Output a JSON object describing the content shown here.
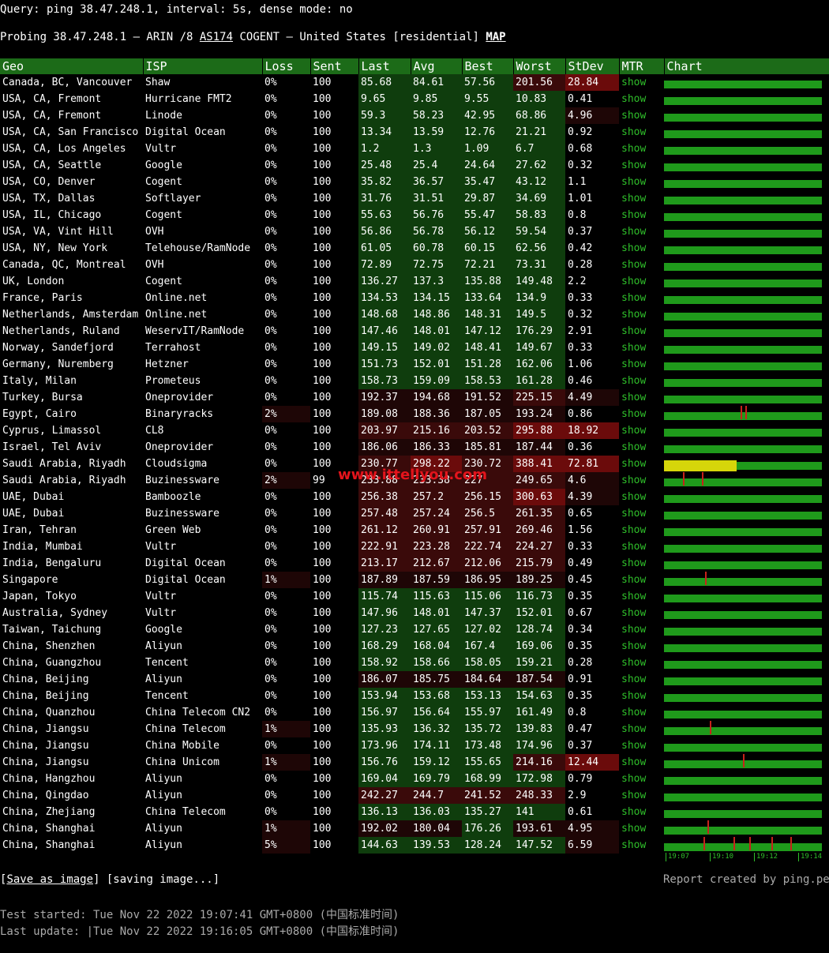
{
  "query_line": "Query: ping 38.47.248.1, interval: 5s, dense mode: no",
  "probe": {
    "prefix": "Probing 38.47.248.1 — ARIN /8 ",
    "as_link": "AS174",
    "middle": " COGENT — United States [residential] ",
    "map_link": "MAP"
  },
  "columns": [
    "Geo",
    "ISP",
    "Loss",
    "Sent",
    "Last",
    "Avg",
    "Best",
    "Worst",
    "StDev",
    "MTR",
    "Chart"
  ],
  "colors": {
    "header_bg": "#1c6b18",
    "good": "#0f3d0d",
    "warn": "#3a0a0a",
    "bad": "#6b0b0b",
    "link": "#2fbf2a",
    "chart": "#1f9a1b",
    "spike": "#c8221b"
  },
  "rows": [
    {
      "geo": "Canada, BC, Vancouver",
      "isp": "Shaw",
      "loss": "0%",
      "sent": "100",
      "last": "85.68",
      "avg": "84.61",
      "best": "57.56",
      "worst": "201.56",
      "stdev": "28.84",
      "mtr": "show"
    },
    {
      "geo": "USA, CA, Fremont",
      "isp": "Hurricane FMT2",
      "loss": "0%",
      "sent": "100",
      "last": "9.65",
      "avg": "9.85",
      "best": "9.55",
      "worst": "10.83",
      "stdev": "0.41",
      "mtr": "show"
    },
    {
      "geo": "USA, CA, Fremont",
      "isp": "Linode",
      "loss": "0%",
      "sent": "100",
      "last": "59.3",
      "avg": "58.23",
      "best": "42.95",
      "worst": "68.86",
      "stdev": "4.96",
      "mtr": "show"
    },
    {
      "geo": "USA, CA, San Francisco",
      "isp": "Digital Ocean",
      "loss": "0%",
      "sent": "100",
      "last": "13.34",
      "avg": "13.59",
      "best": "12.76",
      "worst": "21.21",
      "stdev": "0.92",
      "mtr": "show"
    },
    {
      "geo": "USA, CA, Los Angeles",
      "isp": "Vultr",
      "loss": "0%",
      "sent": "100",
      "last": "1.2",
      "avg": "1.3",
      "best": "1.09",
      "worst": "6.7",
      "stdev": "0.68",
      "mtr": "show"
    },
    {
      "geo": "USA, CA, Seattle",
      "isp": "Google",
      "loss": "0%",
      "sent": "100",
      "last": "25.48",
      "avg": "25.4",
      "best": "24.64",
      "worst": "27.62",
      "stdev": "0.32",
      "mtr": "show"
    },
    {
      "geo": "USA, CO, Denver",
      "isp": "Cogent",
      "loss": "0%",
      "sent": "100",
      "last": "35.82",
      "avg": "36.57",
      "best": "35.47",
      "worst": "43.12",
      "stdev": "1.1",
      "mtr": "show"
    },
    {
      "geo": "USA, TX, Dallas",
      "isp": "Softlayer",
      "loss": "0%",
      "sent": "100",
      "last": "31.76",
      "avg": "31.51",
      "best": "29.87",
      "worst": "34.69",
      "stdev": "1.01",
      "mtr": "show"
    },
    {
      "geo": "USA, IL, Chicago",
      "isp": "Cogent",
      "loss": "0%",
      "sent": "100",
      "last": "55.63",
      "avg": "56.76",
      "best": "55.47",
      "worst": "58.83",
      "stdev": "0.8",
      "mtr": "show"
    },
    {
      "geo": "USA, VA, Vint Hill",
      "isp": "OVH",
      "loss": "0%",
      "sent": "100",
      "last": "56.86",
      "avg": "56.78",
      "best": "56.12",
      "worst": "59.54",
      "stdev": "0.37",
      "mtr": "show"
    },
    {
      "geo": "USA, NY, New York",
      "isp": "Telehouse/RamNode",
      "loss": "0%",
      "sent": "100",
      "last": "61.05",
      "avg": "60.78",
      "best": "60.15",
      "worst": "62.56",
      "stdev": "0.42",
      "mtr": "show"
    },
    {
      "geo": "Canada, QC, Montreal",
      "isp": "OVH",
      "loss": "0%",
      "sent": "100",
      "last": "72.89",
      "avg": "72.75",
      "best": "72.21",
      "worst": "73.31",
      "stdev": "0.28",
      "mtr": "show"
    },
    {
      "geo": "UK, London",
      "isp": "Cogent",
      "loss": "0%",
      "sent": "100",
      "last": "136.27",
      "avg": "137.3",
      "best": "135.88",
      "worst": "149.48",
      "stdev": "2.2",
      "mtr": "show"
    },
    {
      "geo": "France, Paris",
      "isp": "Online.net",
      "loss": "0%",
      "sent": "100",
      "last": "134.53",
      "avg": "134.15",
      "best": "133.64",
      "worst": "134.9",
      "stdev": "0.33",
      "mtr": "show"
    },
    {
      "geo": "Netherlands, Amsterdam",
      "isp": "Online.net",
      "loss": "0%",
      "sent": "100",
      "last": "148.68",
      "avg": "148.86",
      "best": "148.31",
      "worst": "149.5",
      "stdev": "0.32",
      "mtr": "show"
    },
    {
      "geo": "Netherlands, Ruland",
      "isp": "WeservIT/RamNode",
      "loss": "0%",
      "sent": "100",
      "last": "147.46",
      "avg": "148.01",
      "best": "147.12",
      "worst": "176.29",
      "stdev": "2.91",
      "mtr": "show"
    },
    {
      "geo": "Norway, Sandefjord",
      "isp": "Terrahost",
      "loss": "0%",
      "sent": "100",
      "last": "149.15",
      "avg": "149.02",
      "best": "148.41",
      "worst": "149.67",
      "stdev": "0.33",
      "mtr": "show"
    },
    {
      "geo": "Germany, Nuremberg",
      "isp": "Hetzner",
      "loss": "0%",
      "sent": "100",
      "last": "151.73",
      "avg": "152.01",
      "best": "151.28",
      "worst": "162.06",
      "stdev": "1.06",
      "mtr": "show"
    },
    {
      "geo": "Italy, Milan",
      "isp": "Prometeus",
      "loss": "0%",
      "sent": "100",
      "last": "158.73",
      "avg": "159.09",
      "best": "158.53",
      "worst": "161.28",
      "stdev": "0.46",
      "mtr": "show"
    },
    {
      "geo": "Turkey, Bursa",
      "isp": "Oneprovider",
      "loss": "0%",
      "sent": "100",
      "last": "192.37",
      "avg": "194.68",
      "best": "191.52",
      "worst": "225.15",
      "stdev": "4.49",
      "mtr": "show"
    },
    {
      "geo": "Egypt, Cairo",
      "isp": "Binaryracks",
      "loss": "2%",
      "sent": "100",
      "last": "189.08",
      "avg": "188.36",
      "best": "187.05",
      "worst": "193.24",
      "stdev": "0.86",
      "mtr": "show"
    },
    {
      "geo": "Cyprus, Limassol",
      "isp": "CL8",
      "loss": "0%",
      "sent": "100",
      "last": "203.97",
      "avg": "215.16",
      "best": "203.52",
      "worst": "295.88",
      "stdev": "18.92",
      "mtr": "show"
    },
    {
      "geo": "Israel, Tel Aviv",
      "isp": "Oneprovider",
      "loss": "0%",
      "sent": "100",
      "last": "186.06",
      "avg": "186.33",
      "best": "185.81",
      "worst": "187.44",
      "stdev": "0.36",
      "mtr": "show"
    },
    {
      "geo": "Saudi Arabia, Riyadh",
      "isp": "Cloudsigma",
      "loss": "0%",
      "sent": "100",
      "last": "230.77",
      "avg": "298.22",
      "best": "230.72",
      "worst": "388.41",
      "stdev": "72.81",
      "mtr": "show"
    },
    {
      "geo": "Saudi Arabia, Riyadh",
      "isp": "Buzinessware",
      "loss": "2%",
      "sent": "99",
      "last": "233.88",
      "avg": "233.38",
      "best": "227",
      "worst": "249.65",
      "stdev": "4.6",
      "mtr": "show"
    },
    {
      "geo": "UAE, Dubai",
      "isp": "Bamboozle",
      "loss": "0%",
      "sent": "100",
      "last": "256.38",
      "avg": "257.2",
      "best": "256.15",
      "worst": "300.63",
      "stdev": "4.39",
      "mtr": "show"
    },
    {
      "geo": "UAE, Dubai",
      "isp": "Buzinessware",
      "loss": "0%",
      "sent": "100",
      "last": "257.48",
      "avg": "257.24",
      "best": "256.5",
      "worst": "261.35",
      "stdev": "0.65",
      "mtr": "show"
    },
    {
      "geo": "Iran, Tehran",
      "isp": "Green Web",
      "loss": "0%",
      "sent": "100",
      "last": "261.12",
      "avg": "260.91",
      "best": "257.91",
      "worst": "269.46",
      "stdev": "1.56",
      "mtr": "show"
    },
    {
      "geo": "India, Mumbai",
      "isp": "Vultr",
      "loss": "0%",
      "sent": "100",
      "last": "222.91",
      "avg": "223.28",
      "best": "222.74",
      "worst": "224.27",
      "stdev": "0.33",
      "mtr": "show"
    },
    {
      "geo": "India, Bengaluru",
      "isp": "Digital Ocean",
      "loss": "0%",
      "sent": "100",
      "last": "213.17",
      "avg": "212.67",
      "best": "212.06",
      "worst": "215.79",
      "stdev": "0.49",
      "mtr": "show"
    },
    {
      "geo": "Singapore",
      "isp": "Digital Ocean",
      "loss": "1%",
      "sent": "100",
      "last": "187.89",
      "avg": "187.59",
      "best": "186.95",
      "worst": "189.25",
      "stdev": "0.45",
      "mtr": "show"
    },
    {
      "geo": "Japan, Tokyo",
      "isp": "Vultr",
      "loss": "0%",
      "sent": "100",
      "last": "115.74",
      "avg": "115.63",
      "best": "115.06",
      "worst": "116.73",
      "stdev": "0.35",
      "mtr": "show"
    },
    {
      "geo": "Australia, Sydney",
      "isp": "Vultr",
      "loss": "0%",
      "sent": "100",
      "last": "147.96",
      "avg": "148.01",
      "best": "147.37",
      "worst": "152.01",
      "stdev": "0.67",
      "mtr": "show"
    },
    {
      "geo": "Taiwan, Taichung",
      "isp": "Google",
      "loss": "0%",
      "sent": "100",
      "last": "127.23",
      "avg": "127.65",
      "best": "127.02",
      "worst": "128.74",
      "stdev": "0.34",
      "mtr": "show"
    },
    {
      "geo": "China, Shenzhen",
      "isp": "Aliyun",
      "loss": "0%",
      "sent": "100",
      "last": "168.29",
      "avg": "168.04",
      "best": "167.4",
      "worst": "169.06",
      "stdev": "0.35",
      "mtr": "show"
    },
    {
      "geo": "China, Guangzhou",
      "isp": "Tencent",
      "loss": "0%",
      "sent": "100",
      "last": "158.92",
      "avg": "158.66",
      "best": "158.05",
      "worst": "159.21",
      "stdev": "0.28",
      "mtr": "show"
    },
    {
      "geo": "China, Beijing",
      "isp": "Aliyun",
      "loss": "0%",
      "sent": "100",
      "last": "186.07",
      "avg": "185.75",
      "best": "184.64",
      "worst": "187.54",
      "stdev": "0.91",
      "mtr": "show"
    },
    {
      "geo": "China, Beijing",
      "isp": "Tencent",
      "loss": "0%",
      "sent": "100",
      "last": "153.94",
      "avg": "153.68",
      "best": "153.13",
      "worst": "154.63",
      "stdev": "0.35",
      "mtr": "show"
    },
    {
      "geo": "China, Quanzhou",
      "isp": "China Telecom CN2",
      "loss": "0%",
      "sent": "100",
      "last": "156.97",
      "avg": "156.64",
      "best": "155.97",
      "worst": "161.49",
      "stdev": "0.8",
      "mtr": "show"
    },
    {
      "geo": "China, Jiangsu",
      "isp": "China Telecom",
      "loss": "1%",
      "sent": "100",
      "last": "135.93",
      "avg": "136.32",
      "best": "135.72",
      "worst": "139.83",
      "stdev": "0.47",
      "mtr": "show"
    },
    {
      "geo": "China, Jiangsu",
      "isp": "China Mobile",
      "loss": "0%",
      "sent": "100",
      "last": "173.96",
      "avg": "174.11",
      "best": "173.48",
      "worst": "174.96",
      "stdev": "0.37",
      "mtr": "show"
    },
    {
      "geo": "China, Jiangsu",
      "isp": "China Unicom",
      "loss": "1%",
      "sent": "100",
      "last": "156.76",
      "avg": "159.12",
      "best": "155.65",
      "worst": "214.16",
      "stdev": "12.44",
      "mtr": "show"
    },
    {
      "geo": "China, Hangzhou",
      "isp": "Aliyun",
      "loss": "0%",
      "sent": "100",
      "last": "169.04",
      "avg": "169.79",
      "best": "168.99",
      "worst": "172.98",
      "stdev": "0.79",
      "mtr": "show"
    },
    {
      "geo": "China, Qingdao",
      "isp": "Aliyun",
      "loss": "0%",
      "sent": "100",
      "last": "242.27",
      "avg": "244.7",
      "best": "241.52",
      "worst": "248.33",
      "stdev": "2.9",
      "mtr": "show"
    },
    {
      "geo": "China, Zhejiang",
      "isp": "China Telecom",
      "loss": "0%",
      "sent": "100",
      "last": "136.13",
      "avg": "136.03",
      "best": "135.27",
      "worst": "141",
      "stdev": "0.61",
      "mtr": "show"
    },
    {
      "geo": "China, Shanghai",
      "isp": "Aliyun",
      "loss": "1%",
      "sent": "100",
      "last": "192.02",
      "avg": "180.04",
      "best": "176.26",
      "worst": "193.61",
      "stdev": "4.95",
      "mtr": "show"
    },
    {
      "geo": "China, Shanghai",
      "isp": "Aliyun",
      "loss": "5%",
      "sent": "100",
      "last": "144.63",
      "avg": "139.53",
      "best": "128.24",
      "worst": "147.52",
      "stdev": "6.59",
      "mtr": "show"
    }
  ],
  "chart_axis": [
    "19:07",
    "19:10",
    "19:12",
    "19:14"
  ],
  "save": {
    "link": "Save as image",
    "status": "[saving image...]"
  },
  "credit": "Report created by ping.pe",
  "test_started": "Test started: Tue Nov 22 2022 19:07:41 GMT+0800 (中国标准时间)",
  "last_update": "Last update: |Tue Nov 22 2022 19:16:05 GMT+0800 (中国标准时间)",
  "watermark": "www.ittellyou.com"
}
